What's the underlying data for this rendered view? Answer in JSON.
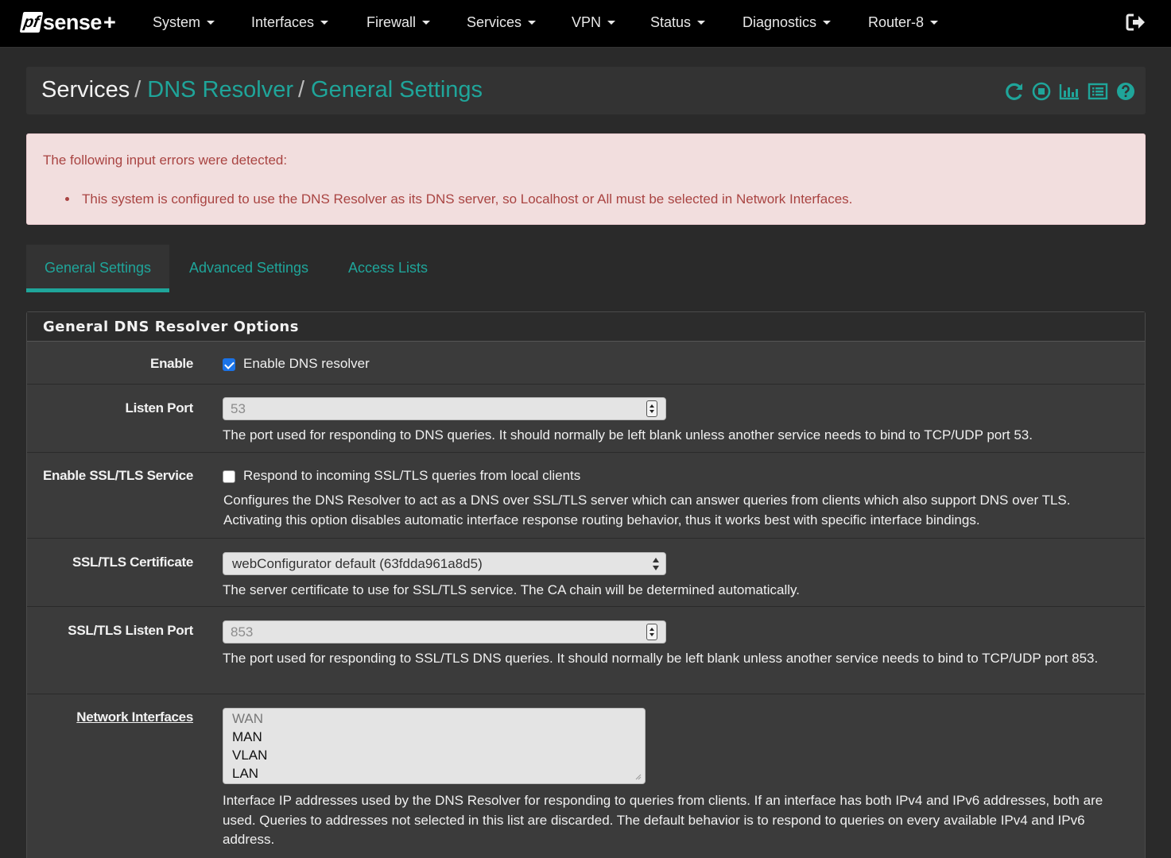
{
  "brand": {
    "pf": "pf",
    "sense": "sense",
    "plus": "+"
  },
  "nav": {
    "items": [
      {
        "label": "System"
      },
      {
        "label": "Interfaces"
      },
      {
        "label": "Firewall"
      },
      {
        "label": "Services"
      },
      {
        "label": "VPN"
      },
      {
        "label": "Status"
      },
      {
        "label": "Diagnostics"
      },
      {
        "label": "Router-8"
      }
    ],
    "logout_icon": "sign-out-icon"
  },
  "breadcrumb": {
    "root": "Services",
    "separator": "/",
    "level1": "DNS Resolver",
    "level2": "General Settings",
    "icons": [
      "restart-icon",
      "stop-icon",
      "chart-icon",
      "log-list-icon",
      "help-icon"
    ]
  },
  "alert": {
    "title": "The following input errors were detected:",
    "items": [
      "This system is configured to use the DNS Resolver as its DNS server, so Localhost or All must be selected in Network Interfaces."
    ]
  },
  "tabs": [
    {
      "label": "General Settings",
      "active": true
    },
    {
      "label": "Advanced Settings",
      "active": false
    },
    {
      "label": "Access Lists",
      "active": false
    }
  ],
  "panel": {
    "title": "General DNS Resolver Options",
    "enable": {
      "label": "Enable",
      "checkbox_label": "Enable DNS resolver",
      "checked": true
    },
    "listen_port": {
      "label": "Listen Port",
      "placeholder": "53",
      "help": "The port used for responding to DNS queries. It should normally be left blank unless another service needs to bind to TCP/UDP port 53."
    },
    "ssl_service": {
      "label": "Enable SSL/TLS Service",
      "checkbox_label": "Respond to incoming SSL/TLS queries from local clients",
      "checked": false,
      "help_line1": "Configures the DNS Resolver to act as a DNS over SSL/TLS server which can answer queries from clients which also support DNS over TLS.",
      "help_line2": "Activating this option disables automatic interface response routing behavior, thus it works best with specific interface bindings."
    },
    "ssl_cert": {
      "label": "SSL/TLS Certificate",
      "selected": "webConfigurator default (63fdda961a8d5)",
      "help": "The server certificate to use for SSL/TLS service. The CA chain will be determined automatically."
    },
    "ssl_port": {
      "label": "SSL/TLS Listen Port",
      "placeholder": "853",
      "help": "The port used for responding to SSL/TLS DNS queries. It should normally be left blank unless another service needs to bind to TCP/UDP port 853."
    },
    "interfaces": {
      "label": "Network Interfaces",
      "options": [
        "WAN",
        "MAN",
        "VLAN",
        "LAN"
      ],
      "help": "Interface IP addresses used by the DNS Resolver for responding to queries from clients. If an interface has both IPv4 and IPv6 addresses, both are used. Queries to addresses not selected in this list are discarded. The default behavior is to respond to queries on every available IPv4 and IPv6 address."
    }
  },
  "colors": {
    "accent": "#1fa59a",
    "navbar": "#000000",
    "alert_bg": "#f2dede",
    "alert_text": "#a94442",
    "panel_bg": "#3b3b3b"
  }
}
